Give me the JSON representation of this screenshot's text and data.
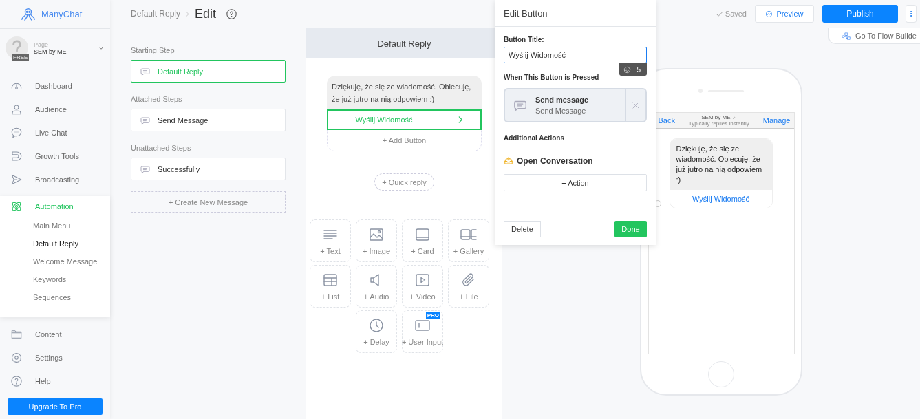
{
  "brand": {
    "name": "ManyChat"
  },
  "page": {
    "label": "Page",
    "name": "SEM by ME",
    "badge": "FREE"
  },
  "nav": [
    {
      "label": "Dashboard",
      "kind": "dashboard",
      "selected": false
    },
    {
      "label": "Audience",
      "kind": "audience",
      "selected": false
    },
    {
      "label": "Live Chat",
      "kind": "chat",
      "selected": false
    },
    {
      "label": "Growth Tools",
      "kind": "growth",
      "selected": false
    },
    {
      "label": "Broadcasting",
      "kind": "broadcast",
      "selected": false
    },
    {
      "label": "Automation",
      "kind": "automation",
      "selected": true,
      "children": [
        {
          "label": "Main Menu",
          "selected": false
        },
        {
          "label": "Default Reply",
          "selected": true
        },
        {
          "label": "Welcome Message",
          "selected": false
        },
        {
          "label": "Keywords",
          "selected": false
        },
        {
          "label": "Sequences",
          "selected": false
        }
      ]
    },
    {
      "label": "Content",
      "kind": "content",
      "selected": false
    },
    {
      "label": "Settings",
      "kind": "settings",
      "selected": false
    },
    {
      "label": "Help",
      "kind": "help",
      "selected": false
    }
  ],
  "upgrade_button": "Upgrade To Pro",
  "header": {
    "breadcrumb": "Default Reply",
    "title": "Edit",
    "saved": "Saved",
    "preview": "Preview",
    "publish": "Publish",
    "flow_builder": "Go To Flow Builde"
  },
  "steps": {
    "sections": [
      {
        "title": "Starting Step",
        "items": [
          {
            "label": "Default Reply",
            "selected": true
          }
        ]
      },
      {
        "title": "Attached Steps",
        "items": [
          {
            "label": "Send Message",
            "selected": false
          }
        ]
      },
      {
        "title": "Unattached Steps",
        "items": [
          {
            "label": "Successfully",
            "selected": false
          }
        ]
      }
    ],
    "create": "+ Create New Message"
  },
  "editor": {
    "title": "Default Reply",
    "message": "Dziękuję, że się ze wiadomość. Obiecuję, że już jutro na nią odpowiem :)",
    "buttons": [
      {
        "label": "Wyślij Widomość",
        "selected": true
      }
    ],
    "add_button": "+ Add Button",
    "quick_reply": "+ Quick reply",
    "blocks": [
      {
        "label": "+ Text",
        "kind": "text"
      },
      {
        "label": "+ Image",
        "kind": "image"
      },
      {
        "label": "+ Card",
        "kind": "card"
      },
      {
        "label": "+ Gallery",
        "kind": "gallery"
      },
      {
        "label": "+ List",
        "kind": "list"
      },
      {
        "label": "+ Audio",
        "kind": "audio"
      },
      {
        "label": "+ Video",
        "kind": "video"
      },
      {
        "label": "+ File",
        "kind": "file"
      },
      {
        "label": "+ Delay",
        "kind": "delay"
      },
      {
        "label": "+ User Input",
        "kind": "input",
        "badge": "PRO"
      }
    ]
  },
  "edit_button": {
    "title": "Edit Button",
    "field_label": "Button Title:",
    "value": "Wyślij Widomość",
    "counter": "5",
    "pressed_label": "When This Button is Pressed",
    "action": {
      "title": "Send message",
      "subtitle": "Send Message"
    },
    "additional_label": "Additional Actions",
    "additional": [
      {
        "label": "Open Conversation"
      }
    ],
    "add_action": "+ Action",
    "delete": "Delete",
    "done": "Done"
  },
  "preview": {
    "back": "Back",
    "page_name": "SEM by ME",
    "status": "Typically replies instantly",
    "manage": "Manage",
    "message": "Dziękuję, że się ze wiadomość. Obiecuję, że już jutro na nią odpowiem :)",
    "buttons": [
      "Wyślij Widomość"
    ]
  }
}
